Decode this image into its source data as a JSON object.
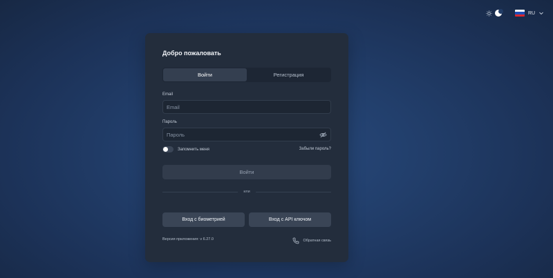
{
  "header": {
    "language_code": "RU",
    "theme_icons": [
      "sun-icon",
      "moon-icon"
    ],
    "flag_icon": "russia-flag-icon"
  },
  "login": {
    "title": "Добро пожаловать",
    "tabs": [
      {
        "label": "Войти",
        "active": true
      },
      {
        "label": "Регистрация",
        "active": false
      }
    ],
    "email": {
      "label": "Email",
      "placeholder": "Email",
      "value": ""
    },
    "password": {
      "label": "Пароль",
      "placeholder": "Пароль",
      "value": ""
    },
    "remember_label": "Запомнить меня",
    "remember_checked": false,
    "forgot_label": "Забыли пароль?",
    "submit_label": "Войти",
    "divider_label": "или",
    "biometric_label": "Вход с биометрией",
    "api_key_label": "Вход с API ключом",
    "version_label": "Версия приложения: v 6.27.0",
    "feedback_label": "Обратная связь"
  },
  "colors": {
    "card_bg": "#232d3c",
    "active_tab": "#343f50",
    "button_bg": "#3a4556"
  }
}
